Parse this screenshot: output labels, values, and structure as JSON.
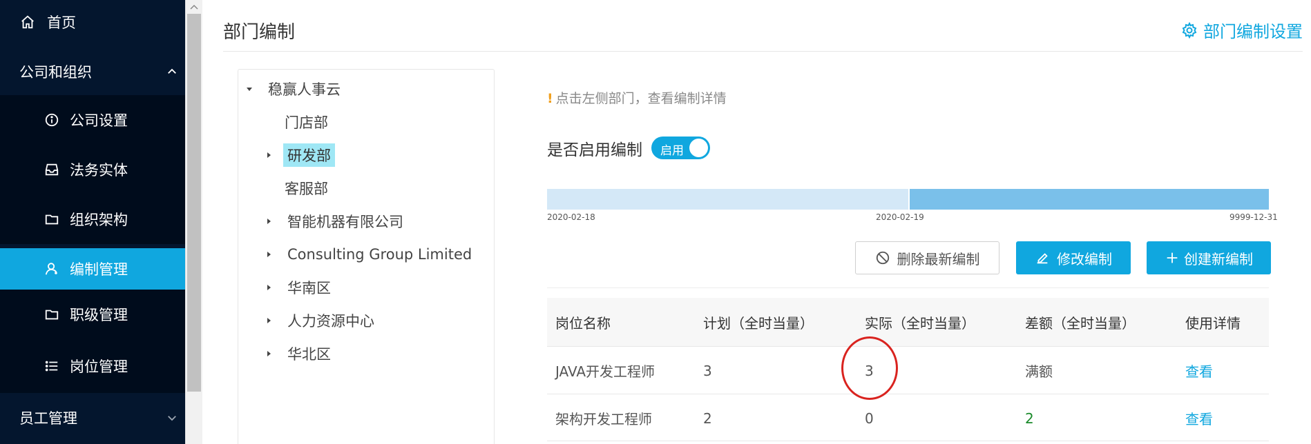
{
  "sidebar": {
    "home": {
      "label": "首页",
      "icon": "home-icon"
    },
    "group": {
      "label": "公司和组织",
      "icon": "chevron-up-icon"
    },
    "items": [
      {
        "label": "公司设置",
        "icon": "info-icon"
      },
      {
        "label": "法务实体",
        "icon": "inbox-icon"
      },
      {
        "label": "组织架构",
        "icon": "folder-icon"
      },
      {
        "label": "编制管理",
        "icon": "user-icon",
        "active": true
      },
      {
        "label": "职级管理",
        "icon": "folder-icon"
      },
      {
        "label": "岗位管理",
        "icon": "list-icon"
      }
    ],
    "employee_group": {
      "label": "员工管理",
      "icon": "chevron-down-icon"
    }
  },
  "header": {
    "title": "部门编制",
    "settings_label": "部门编制设置"
  },
  "tree": {
    "root": "稳赢人事云",
    "nodes": [
      {
        "label": "门店部",
        "has_children": false
      },
      {
        "label": "研发部",
        "has_children": true,
        "selected": true
      },
      {
        "label": "客服部",
        "has_children": false
      },
      {
        "label": "智能机器有限公司",
        "has_children": true
      },
      {
        "label": "Consulting Group Limited",
        "has_children": true
      },
      {
        "label": "华南区",
        "has_children": true
      },
      {
        "label": "人力资源中心",
        "has_children": true
      },
      {
        "label": "华北区",
        "has_children": true
      }
    ]
  },
  "content": {
    "hint_mark": "!",
    "hint": "点击左侧部门，查看编制详情",
    "enable_label": "是否启用编制",
    "switch_text": "启用",
    "switch_on": true,
    "timeline": [
      "2020-02-18",
      "2020-02-19",
      "9999-12-31"
    ],
    "buttons": {
      "delete": "删除最新编制",
      "edit": "修改编制",
      "create": "创建新编制"
    },
    "table": {
      "headers": [
        "岗位名称",
        "计划（全时当量）",
        "实际（全时当量）",
        "差额（全时当量）",
        "使用详情"
      ],
      "rows": [
        {
          "name": "JAVA开发工程师",
          "plan": "3",
          "actual": "3",
          "diff": "满额",
          "detail": "查看"
        },
        {
          "name": "架构开发工程师",
          "plan": "2",
          "actual": "0",
          "diff": "2",
          "detail": "查看"
        }
      ]
    }
  },
  "colors": {
    "accent": "#10a7df",
    "sidebar_bg": "#04162e",
    "annotation": "#d9231f",
    "positive": "#1a8a2a"
  }
}
